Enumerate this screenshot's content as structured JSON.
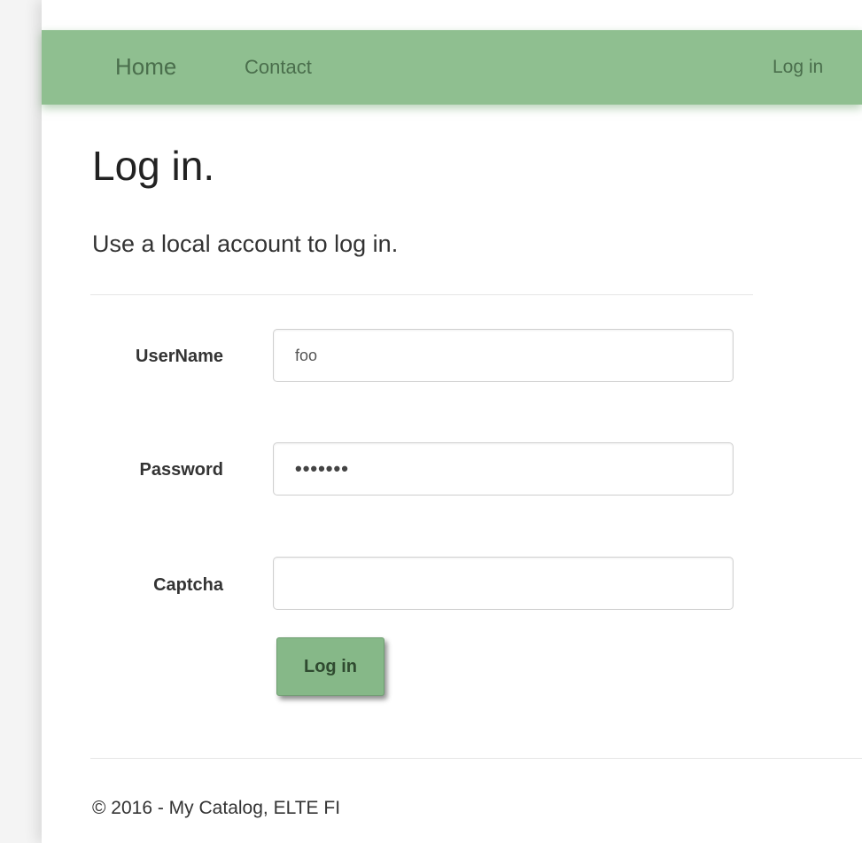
{
  "nav": {
    "home_label": "Home",
    "contact_label": "Contact",
    "login_label": "Log in"
  },
  "main": {
    "title": "Log in.",
    "subtitle": "Use a local account to log in."
  },
  "form": {
    "username": {
      "label": "UserName",
      "value": "foo"
    },
    "password": {
      "label": "Password",
      "value": "•••••••"
    },
    "captcha": {
      "label": "Captcha",
      "value": ""
    },
    "submit_label": "Log in"
  },
  "footer": {
    "text": "© 2016 - My Catalog, ELTE FI"
  },
  "colors": {
    "navbar_bg": "#8fbf90",
    "nav_text": "#4a6e4c",
    "button_bg": "#86b888"
  }
}
